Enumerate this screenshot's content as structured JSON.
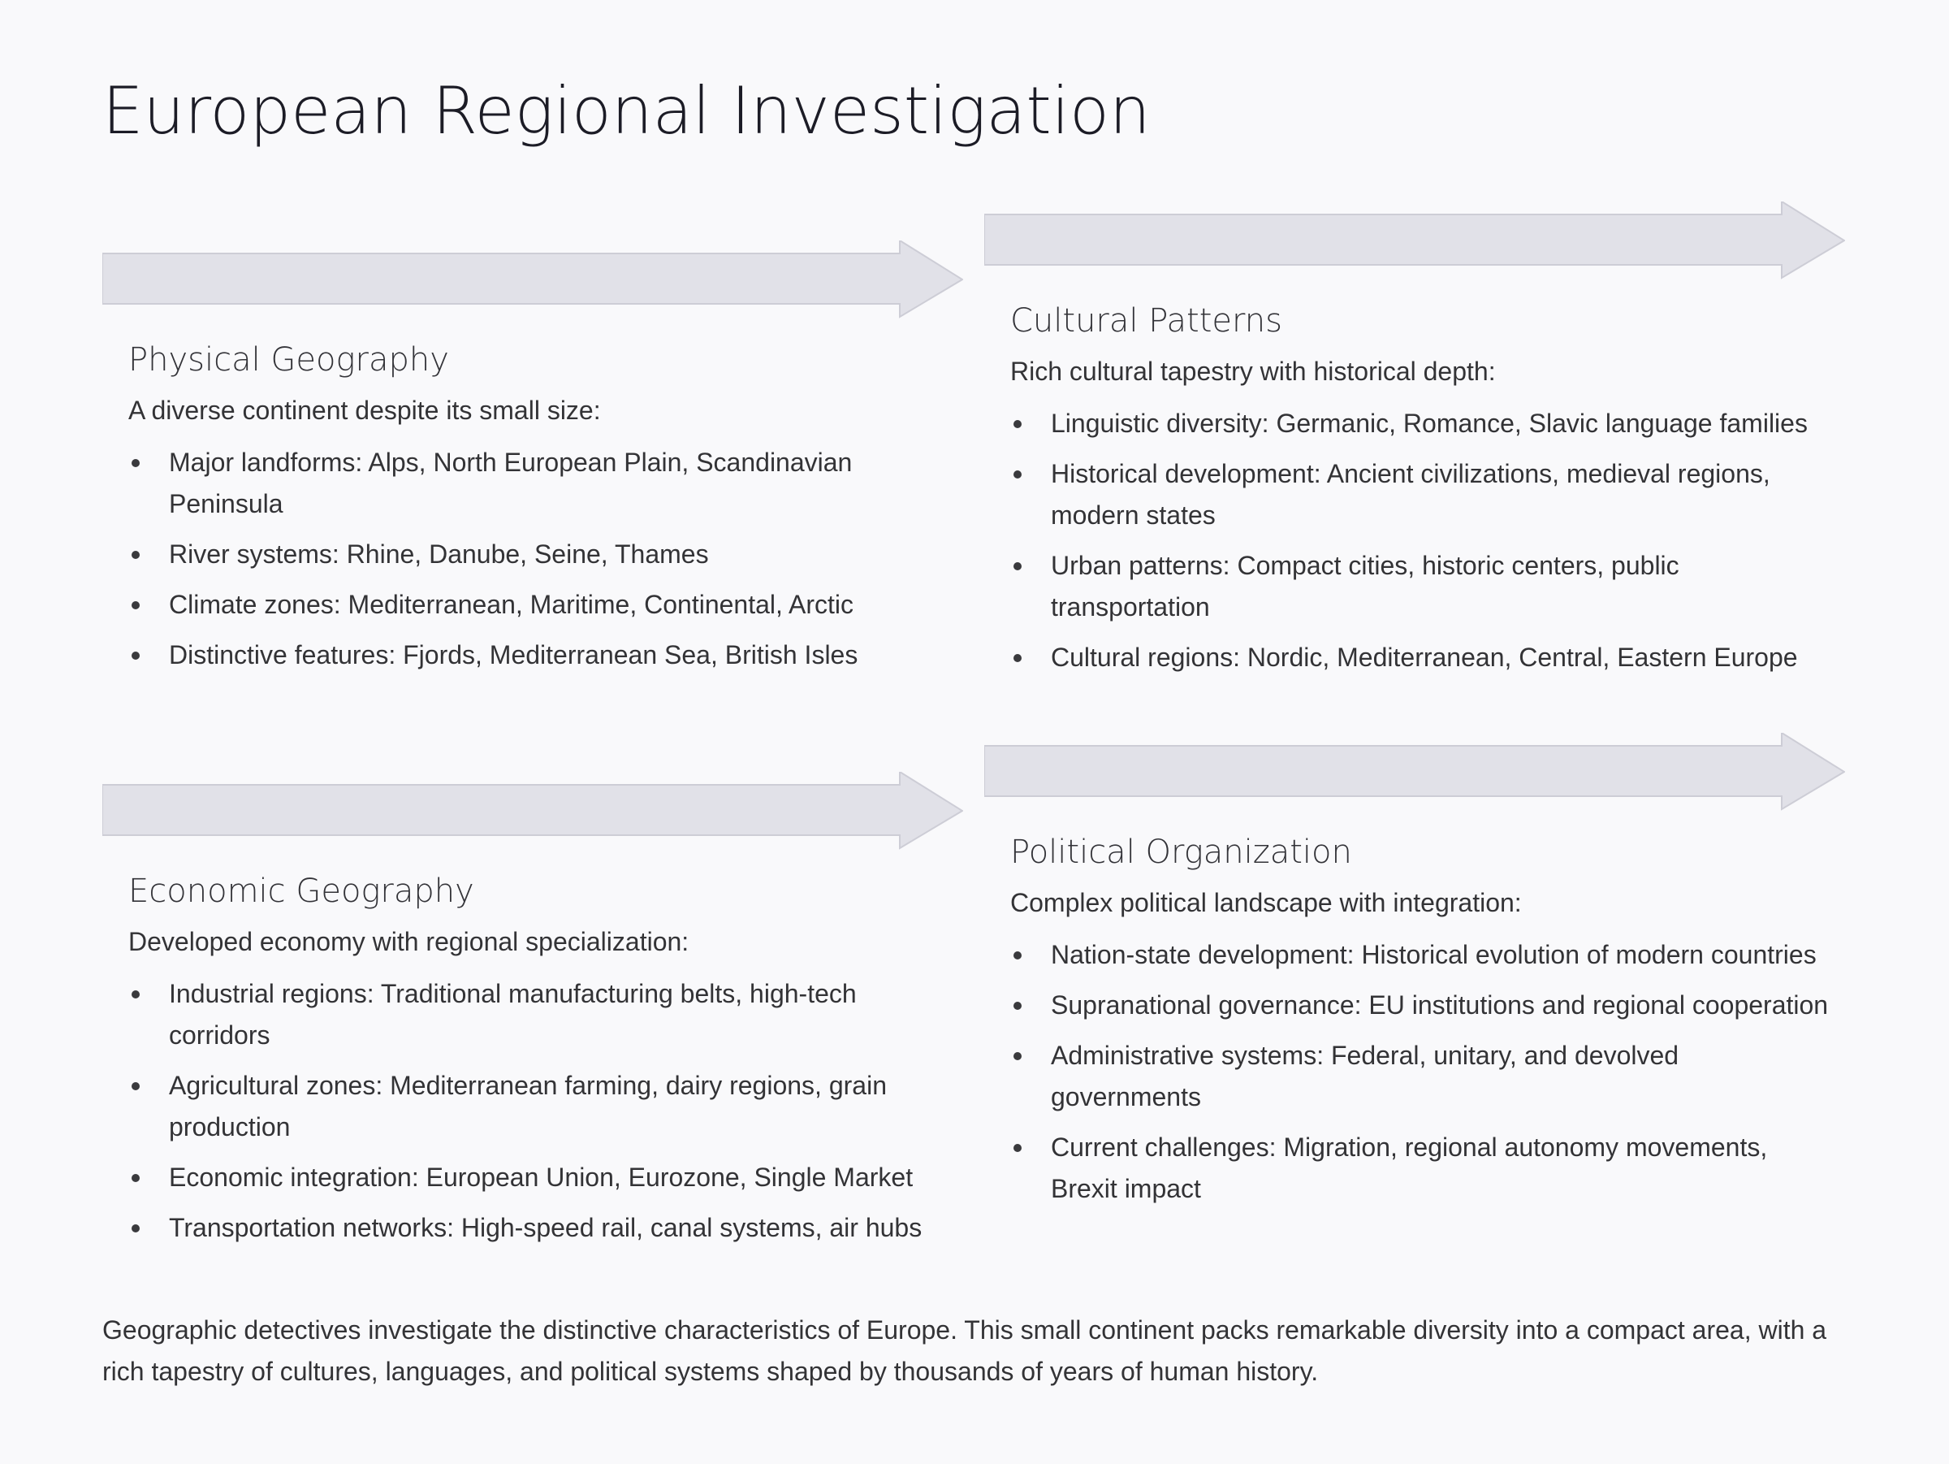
{
  "page": {
    "title": "European Regional Investigation",
    "footer": "Geographic detectives investigate the distinctive characteristics of Europe. This small continent packs remarkable diversity into a compact area, with a rich tapestry of cultures, languages, and political systems shaped by thousands of years of human history."
  },
  "colors": {
    "background": "#f9f9fb",
    "arrow_fill": "#e1e1e8",
    "arrow_stroke": "#cdcdd6",
    "title_text": "#1c1c26",
    "body_text": "#333336"
  },
  "sections": {
    "physical": {
      "heading": "Physical Geography",
      "intro": "A diverse continent despite its small size:",
      "items": [
        "Major landforms: Alps, North European Plain, Scandinavian Peninsula",
        "River systems: Rhine, Danube, Seine, Thames",
        "Climate zones: Mediterranean, Maritime, Continental, Arctic",
        "Distinctive features: Fjords, Mediterranean Sea, British Isles"
      ]
    },
    "cultural": {
      "heading": "Cultural Patterns",
      "intro": "Rich cultural tapestry with historical depth:",
      "items": [
        "Linguistic diversity: Germanic, Romance, Slavic language families",
        "Historical development: Ancient civilizations, medieval regions, modern states",
        "Urban patterns: Compact cities, historic centers, public transportation",
        "Cultural regions: Nordic, Mediterranean, Central, Eastern Europe"
      ]
    },
    "economic": {
      "heading": "Economic Geography",
      "intro": "Developed economy with regional specialization:",
      "items": [
        "Industrial regions: Traditional manufacturing belts, high-tech corridors",
        "Agricultural zones: Mediterranean farming, dairy regions, grain production",
        "Economic integration: European Union, Eurozone, Single Market",
        "Transportation networks: High-speed rail, canal systems, air hubs"
      ]
    },
    "political": {
      "heading": "Political Organization",
      "intro": "Complex political landscape with integration:",
      "items": [
        "Nation-state development: Historical evolution of modern countries",
        "Supranational governance: EU institutions and regional cooperation",
        "Administrative systems: Federal, unitary, and devolved governments",
        "Current challenges: Migration, regional autonomy movements, Brexit impact"
      ]
    }
  }
}
